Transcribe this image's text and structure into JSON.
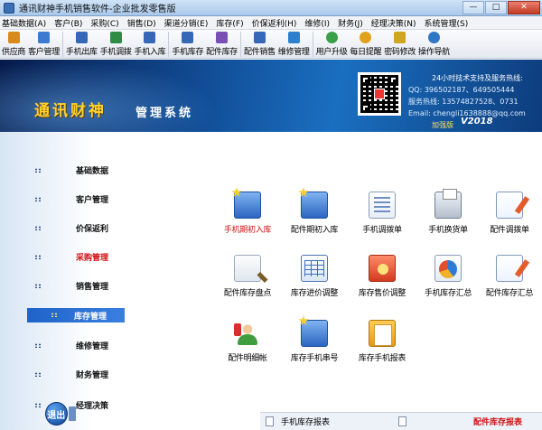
{
  "window": {
    "title": "通讯财神手机销售软件-企业批发零售版",
    "minimize": "—",
    "maximize": "□",
    "close": "✕"
  },
  "menu": [
    "基础数据(A)",
    "客户(B)",
    "采购(C)",
    "销售(D)",
    "渠道分销(E)",
    "库存(F)",
    "价保返利(H)",
    "维修(I)",
    "财务(J)",
    "经理决策(N)",
    "系统管理(S)"
  ],
  "toolbar": [
    {
      "label": "供应商",
      "color": "#d98a1c"
    },
    {
      "label": "客户管理",
      "color": "#3d7bd1"
    },
    {
      "label": "手机出库",
      "color": "#3569b8"
    },
    {
      "label": "手机调拨",
      "color": "#2f8c45"
    },
    {
      "label": "手机入库",
      "color": "#3569b8"
    },
    {
      "label": "手机库存",
      "color": "#3569b8"
    },
    {
      "label": "配件库存",
      "color": "#7a4fb4"
    },
    {
      "label": "配件销售",
      "color": "#3569b8"
    },
    {
      "label": "维修管理",
      "color": "#2d7fcf"
    },
    {
      "label": "用户升级",
      "color": "#3aa04a"
    },
    {
      "label": "每日提醒",
      "color": "#e0a21c"
    },
    {
      "label": "密码修改",
      "color": "#d1a51f"
    },
    {
      "label": "操作导航",
      "color": "#2f76c4"
    }
  ],
  "banner": {
    "brand": "通讯财神",
    "subtitle": "管理系统",
    "edition": "加强版",
    "version": "V2018",
    "contact": {
      "hotline": "24小时技术支持及服务热线:",
      "qq": "QQ: 396502187、649505444",
      "phone": "服务热线: 13574827528、0731",
      "email": "Email: chengli1638888@qq.com"
    }
  },
  "sidebar": [
    {
      "label": "基础数据",
      "state": "normal"
    },
    {
      "label": "客户管理",
      "state": "normal"
    },
    {
      "label": "价保返利",
      "state": "normal"
    },
    {
      "label": "采购管理",
      "state": "red"
    },
    {
      "label": "销售管理",
      "state": "normal"
    },
    {
      "label": "库存管理",
      "state": "active"
    },
    {
      "label": "维修管理",
      "state": "normal"
    },
    {
      "label": "财务管理",
      "state": "normal"
    },
    {
      "label": "经理决策",
      "state": "normal"
    }
  ],
  "exit_label": "退出",
  "main_items": [
    {
      "label": "手机期初入库",
      "state": "red",
      "icon": "folder-star-icon"
    },
    {
      "label": "配件期初入库",
      "state": "normal",
      "icon": "folder-star-icon"
    },
    {
      "label": "手机调拨单",
      "state": "normal",
      "icon": "document-list-icon"
    },
    {
      "label": "手机换货单",
      "state": "normal",
      "icon": "printer-icon"
    },
    {
      "label": "配件调拨单",
      "state": "normal",
      "icon": "note-edit-icon"
    },
    {
      "label": "配件库存盘点",
      "state": "normal",
      "icon": "magnifier-icon"
    },
    {
      "label": "库存进价调整",
      "state": "normal",
      "icon": "table-icon"
    },
    {
      "label": "库存售价调整",
      "state": "normal",
      "icon": "price-tag-icon"
    },
    {
      "label": "手机库存汇总",
      "state": "normal",
      "icon": "chart-search-icon"
    },
    {
      "label": "配件库存汇总",
      "state": "normal",
      "icon": "note-edit-icon"
    },
    {
      "label": "配件明细帐",
      "state": "normal",
      "icon": "people-icon"
    },
    {
      "label": "库存手机串号",
      "state": "normal",
      "icon": "folder-star-icon"
    },
    {
      "label": "库存手机报表",
      "state": "normal",
      "icon": "book-icon"
    }
  ],
  "bottom": {
    "left": "手机库存报表",
    "right": "配件库存报表"
  }
}
